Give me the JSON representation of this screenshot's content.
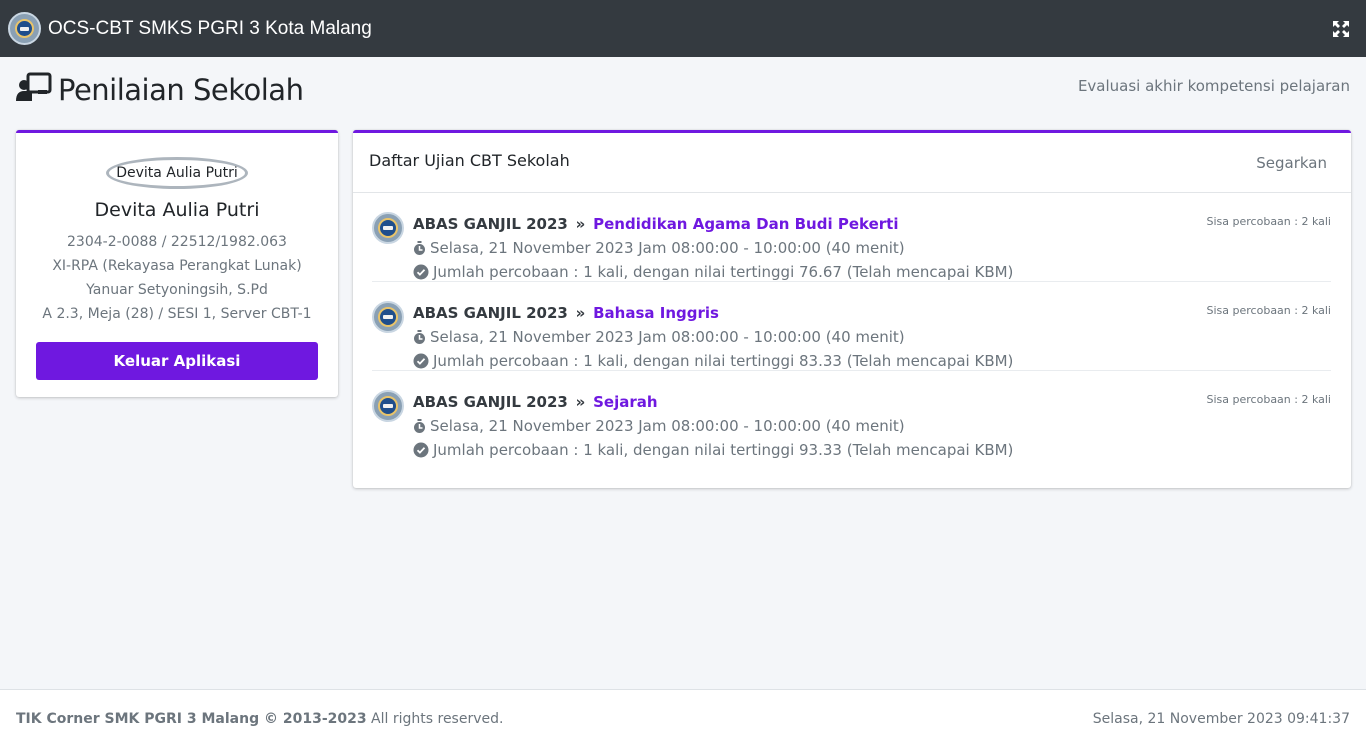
{
  "app": {
    "title": "OCS-CBT SMKS PGRI 3 Kota Malang",
    "fullscreen_icon": "expand-icon"
  },
  "header": {
    "title": "Penilaian Sekolah",
    "subtitle": "Evaluasi akhir kompetensi pelajaran",
    "icon": "chalkboard-teacher-icon"
  },
  "profile": {
    "avatar_alt": "Devita Aulia Putri",
    "name": "Devita Aulia Putri",
    "id_line": "2304-2-0088 / 22512/1982.063",
    "class_line": "XI-RPA (Rekayasa Perangkat Lunak)",
    "teacher_line": "Yanuar Setyoningsih, S.Pd",
    "room_line": "A 2.3, Meja (28) / SESI 1, Server CBT-1",
    "logout_label": "Keluar Aplikasi"
  },
  "exams": {
    "title": "Daftar Ujian CBT Sekolah",
    "refresh_label": "Segarkan",
    "items": [
      {
        "group": "ABAS GANJIL 2023",
        "subject": "Pendidikan Agama Dan Budi Pekerti",
        "remaining": "Sisa percobaan : 2 kali",
        "schedule": "Selasa, 21 November 2023 Jam 08:00:00 - 10:00:00 (40 menit)",
        "result": "Jumlah percobaan : 1 kali, dengan nilai tertinggi 76.67 (Telah mencapai KBM)"
      },
      {
        "group": "ABAS GANJIL 2023",
        "subject": "Bahasa Inggris",
        "remaining": "Sisa percobaan : 2 kali",
        "schedule": "Selasa, 21 November 2023 Jam 08:00:00 - 10:00:00 (40 menit)",
        "result": "Jumlah percobaan : 1 kali, dengan nilai tertinggi 83.33 (Telah mencapai KBM)"
      },
      {
        "group": "ABAS GANJIL 2023",
        "subject": "Sejarah",
        "remaining": "Sisa percobaan : 2 kali",
        "schedule": "Selasa, 21 November 2023 Jam 08:00:00 - 10:00:00 (40 menit)",
        "result": "Jumlah percobaan : 1 kali, dengan nilai tertinggi 93.33 (Telah mencapai KBM)"
      }
    ]
  },
  "footer": {
    "brand": "TIK Corner SMK PGRI 3 Malang © 2013-2023",
    "rights": "All rights reserved.",
    "datetime": "Selasa, 21 November 2023 09:41:37"
  },
  "colors": {
    "topbar": "#343a40",
    "accent": "#6f18e0",
    "muted": "#6c757d",
    "background": "#f4f6f9"
  }
}
